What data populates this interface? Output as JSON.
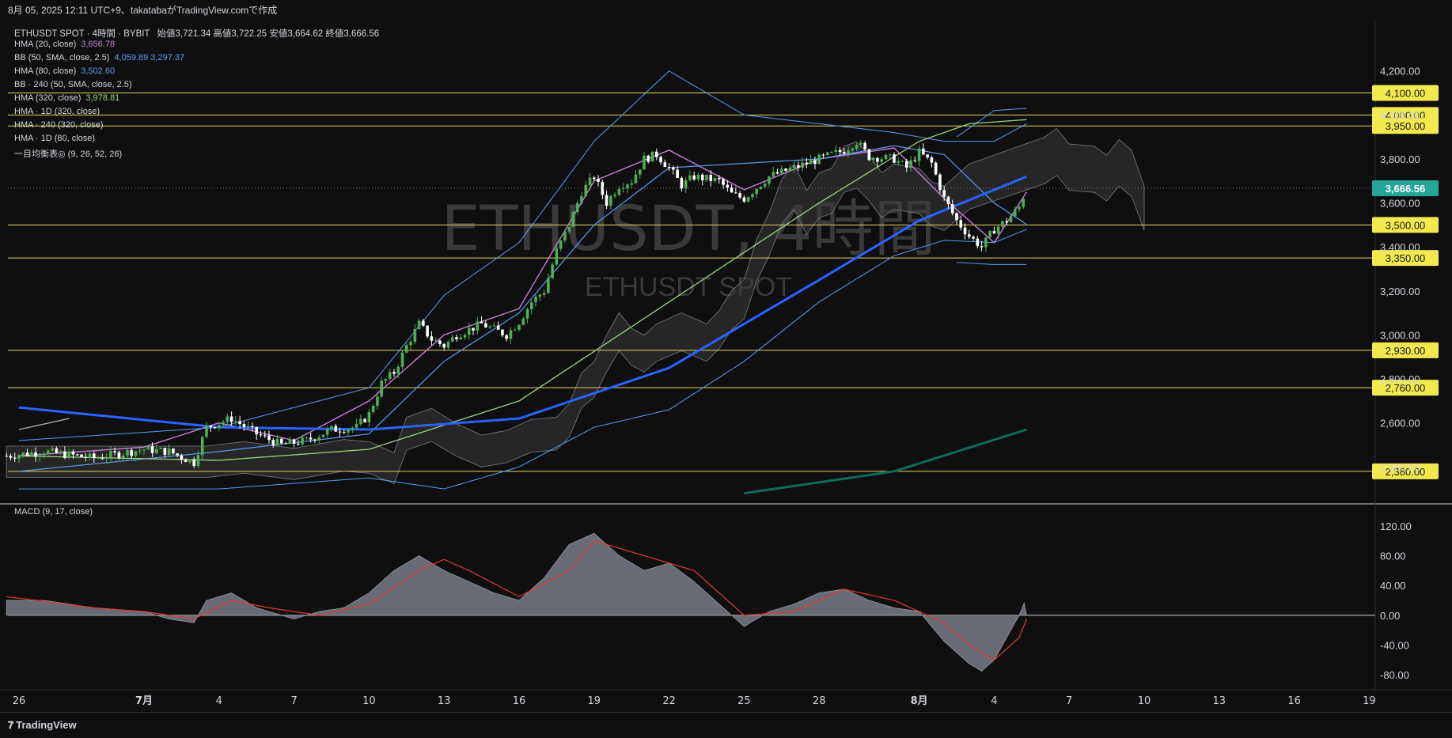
{
  "header": {
    "text": "8月 05, 2025 12:11 UTC+9、takatabaがTradingView.comで作成"
  },
  "legend": {
    "symbol": "ETHUSDT SPOT · 4時間 · BYBIT",
    "ohlc": "始値3,721.34 高値3,722.25 安値3,664.62 終値3,666.56",
    "items": [
      {
        "label": "HMA (20, close)",
        "values": "3,656.78",
        "color": "#c77dd8"
      },
      {
        "label": "BB (50, SMA, close, 2.5)",
        "values": "4,059.89 3,297.37",
        "color": "#5b9cf6"
      },
      {
        "label": "HMA (80, close)",
        "values": "3,502.60",
        "color": "#5b9cf6"
      },
      {
        "label": "BB · 240 (50, SMA, close, 2.5)",
        "values": "",
        "color": "#d1d4dc"
      },
      {
        "label": "HMA (320, close)",
        "values": "3,978.81",
        "color": "#9ad47f"
      },
      {
        "label": "HMA · 1D (320, close)",
        "values": "",
        "color": "#d1d4dc"
      },
      {
        "label": "HMA · 240 (320, close)",
        "values": "",
        "color": "#d1d4dc"
      },
      {
        "label": "HMA · 1D (80, close)",
        "values": "",
        "color": "#d1d4dc"
      },
      {
        "label": "一目均衡表◎ (9, 26, 52, 26)",
        "values": "",
        "color": "#d1d4dc"
      }
    ],
    "macd_label": "MACD (9, 17, close)"
  },
  "watermark": {
    "line1": "ETHUSDT, 4時間",
    "line2": "ETHUSDT SPOT"
  },
  "footer": {
    "logo": "TradingView"
  },
  "colors": {
    "background": "#0f0f0f",
    "up": "#4caf50",
    "down": "#ffffff",
    "level": "#e8d65c",
    "price_badge": "#26a69a",
    "hma20": "#c77dd8",
    "bb": "#5b9cf6",
    "hma80": "#5b9cf6",
    "hma240": "#2962ff",
    "hma320": "#9ad47f",
    "hma1d": "#0f6b5c",
    "macd_fill": "#787b86",
    "signal": "#e53935"
  },
  "chart_data": [
    {
      "type": "candlestick",
      "title": "ETHUSDT SPOT · 4時間 · BYBIT",
      "ylim": [
        2250,
        4350
      ],
      "y_ticks": [
        "2,400.00",
        "2,600.00",
        "2,800.00",
        "3,000.00",
        "3,200.00",
        "3,400.00",
        "3,600.00",
        "3,800.00",
        "4,000.00",
        "4,200.00"
      ],
      "x_ticks": [
        {
          "label": "26",
          "day": -5
        },
        {
          "label": "7月",
          "day": 0
        },
        {
          "label": "4",
          "day": 3
        },
        {
          "label": "7",
          "day": 6
        },
        {
          "label": "10",
          "day": 9
        },
        {
          "label": "13",
          "day": 12
        },
        {
          "label": "16",
          "day": 15
        },
        {
          "label": "19",
          "day": 18
        },
        {
          "label": "22",
          "day": 21
        },
        {
          "label": "25",
          "day": 24
        },
        {
          "label": "28",
          "day": 27
        },
        {
          "label": "8月",
          "day": 31
        },
        {
          "label": "4",
          "day": 34
        },
        {
          "label": "7",
          "day": 37
        },
        {
          "label": "10",
          "day": 40
        },
        {
          "label": "13",
          "day": 43
        },
        {
          "label": "16",
          "day": 46
        },
        {
          "label": "19",
          "day": 49
        }
      ],
      "horizontal_levels": [
        {
          "value": 4100,
          "label": "4,100.00"
        },
        {
          "value": 4000,
          "label": "4,000.00"
        },
        {
          "value": 3950,
          "label": "3,950.00"
        },
        {
          "value": 3500,
          "label": "3,500.00"
        },
        {
          "value": 3350,
          "label": "3,350.00"
        },
        {
          "value": 2930,
          "label": "2,930.00"
        },
        {
          "value": 2760,
          "label": "2,760.00"
        },
        {
          "value": 2380,
          "label": "2,380.00"
        }
      ],
      "last_price": {
        "value": 3666.56,
        "label": "3,666.56"
      },
      "anchors_day_close": [
        [
          -5.5,
          2450
        ],
        [
          -4,
          2470
        ],
        [
          -2,
          2440
        ],
        [
          0,
          2480
        ],
        [
          1,
          2470
        ],
        [
          2,
          2420
        ],
        [
          2.5,
          2580
        ],
        [
          3.5,
          2620
        ],
        [
          4.5,
          2550
        ],
        [
          5.5,
          2500
        ],
        [
          6.5,
          2520
        ],
        [
          7.5,
          2570
        ],
        [
          8.5,
          2580
        ],
        [
          9,
          2640
        ],
        [
          9.5,
          2780
        ],
        [
          10,
          2830
        ],
        [
          10.5,
          2950
        ],
        [
          11,
          3050
        ],
        [
          11.5,
          2980
        ],
        [
          12,
          2950
        ],
        [
          12.5,
          3000
        ],
        [
          13.5,
          3050
        ],
        [
          14.5,
          3000
        ],
        [
          15,
          3060
        ],
        [
          15.5,
          3150
        ],
        [
          16,
          3200
        ],
        [
          16.5,
          3380
        ],
        [
          17,
          3500
        ],
        [
          17.5,
          3650
        ],
        [
          18,
          3720
        ],
        [
          18.5,
          3600
        ],
        [
          19,
          3680
        ],
        [
          19.5,
          3700
        ],
        [
          20,
          3800
        ],
        [
          20.5,
          3820
        ],
        [
          21,
          3760
        ],
        [
          21.5,
          3680
        ],
        [
          22,
          3720
        ],
        [
          23,
          3700
        ],
        [
          23.5,
          3640
        ],
        [
          24,
          3620
        ],
        [
          25,
          3720
        ],
        [
          26,
          3760
        ],
        [
          27,
          3800
        ],
        [
          28,
          3840
        ],
        [
          28.5,
          3880
        ],
        [
          29,
          3810
        ],
        [
          30,
          3800
        ],
        [
          30.5,
          3760
        ],
        [
          31,
          3830
        ],
        [
          31.5,
          3780
        ],
        [
          32,
          3620
        ],
        [
          32.5,
          3520
        ],
        [
          33,
          3450
        ],
        [
          33.5,
          3400
        ],
        [
          34,
          3480
        ],
        [
          34.5,
          3520
        ],
        [
          35,
          3580
        ],
        [
          35.3,
          3670
        ]
      ],
      "series": [
        {
          "name": "HMA (20, close)",
          "values_at": [
            [
              -5,
              2450
            ],
            [
              0,
              2490
            ],
            [
              3,
              2600
            ],
            [
              6,
              2520
            ],
            [
              9,
              2700
            ],
            [
              12,
              3000
            ],
            [
              15,
              3120
            ],
            [
              18,
              3700
            ],
            [
              21,
              3840
            ],
            [
              24,
              3660
            ],
            [
              27,
              3800
            ],
            [
              30,
              3850
            ],
            [
              32,
              3620
            ],
            [
              34,
              3420
            ],
            [
              35.3,
              3650
            ]
          ]
        },
        {
          "name": "BB (50, SMA, close, 2.5)",
          "upper": [
            [
              -5,
              2520
            ],
            [
              3,
              2580
            ],
            [
              9,
              2760
            ],
            [
              12,
              3180
            ],
            [
              15,
              3420
            ],
            [
              18,
              3880
            ],
            [
              21,
              4200
            ],
            [
              24,
              4000
            ],
            [
              27,
              3960
            ],
            [
              30,
              3920
            ],
            [
              32,
              3880
            ],
            [
              34,
              3880
            ],
            [
              35.3,
              3960
            ]
          ],
          "lower": [
            [
              -5,
              2300
            ],
            [
              3,
              2300
            ],
            [
              9,
              2350
            ],
            [
              12,
              2300
            ],
            [
              15,
              2400
            ],
            [
              18,
              2580
            ],
            [
              21,
              2660
            ],
            [
              24,
              2880
            ],
            [
              27,
              3150
            ],
            [
              30,
              3360
            ],
            [
              32,
              3430
            ],
            [
              34,
              3420
            ],
            [
              35.3,
              3480
            ]
          ]
        },
        {
          "name": "HMA (80, close)",
          "values_at": [
            [
              -5,
              2380
            ],
            [
              3,
              2470
            ],
            [
              9,
              2550
            ],
            [
              12,
              2880
            ],
            [
              15,
              3100
            ],
            [
              18,
              3500
            ],
            [
              21,
              3760
            ],
            [
              24,
              3780
            ],
            [
              27,
              3800
            ],
            [
              30,
              3860
            ],
            [
              32,
              3820
            ],
            [
              34,
              3600
            ],
            [
              35.3,
              3502.6
            ]
          ]
        },
        {
          "name": "BB · 240 (50, SMA, close, 2.5)",
          "upper": [
            [
              32.5,
              3900
            ],
            [
              34,
              4020
            ],
            [
              35.3,
              4030
            ]
          ],
          "lower": [
            [
              32.5,
              3330
            ],
            [
              34,
              3320
            ],
            [
              35.3,
              3320
            ]
          ]
        },
        {
          "name": "HMA (320, close)",
          "values_at": [
            [
              -5,
              2450
            ],
            [
              3,
              2430
            ],
            [
              9,
              2480
            ],
            [
              15,
              2700
            ],
            [
              21,
              3150
            ],
            [
              27,
              3600
            ],
            [
              31,
              3880
            ],
            [
              33,
              3960
            ],
            [
              35.3,
              3978.81
            ]
          ]
        },
        {
          "name": "HMA · 240 (320, close)",
          "values_at": [
            [
              -5,
              2670
            ],
            [
              3,
              2580
            ],
            [
              9,
              2570
            ],
            [
              15,
              2620
            ],
            [
              21,
              2850
            ],
            [
              27,
              3250
            ],
            [
              31,
              3520
            ],
            [
              35.3,
              3720
            ]
          ]
        },
        {
          "name": "HMA · 1D (320, close)",
          "values_at": [
            [
              -5,
              2570
            ],
            [
              -3,
              2620
            ]
          ]
        },
        {
          "name": "HMA · 1D (80, close)",
          "values_at": [
            [
              24,
              2280
            ],
            [
              30,
              2380
            ],
            [
              35.3,
              2570
            ]
          ]
        }
      ]
    },
    {
      "type": "area",
      "title": "MACD (9, 17, close)",
      "ylim": [
        -100,
        140
      ],
      "y_ticks": [
        "-80.00",
        "-40.00",
        "0.00",
        "40.00",
        "80.00",
        "120.00"
      ],
      "macd": [
        [
          -5.5,
          20
        ],
        [
          -4,
          20
        ],
        [
          -2,
          10
        ],
        [
          0,
          5
        ],
        [
          1,
          -5
        ],
        [
          2,
          -10
        ],
        [
          2.5,
          20
        ],
        [
          3.5,
          30
        ],
        [
          4.5,
          10
        ],
        [
          6,
          -5
        ],
        [
          7,
          5
        ],
        [
          8,
          10
        ],
        [
          9,
          30
        ],
        [
          10,
          60
        ],
        [
          11,
          80
        ],
        [
          12,
          60
        ],
        [
          13,
          45
        ],
        [
          14,
          30
        ],
        [
          15,
          20
        ],
        [
          16,
          50
        ],
        [
          17,
          95
        ],
        [
          18,
          110
        ],
        [
          19,
          80
        ],
        [
          20,
          60
        ],
        [
          21,
          70
        ],
        [
          22,
          45
        ],
        [
          23,
          15
        ],
        [
          24,
          -15
        ],
        [
          25,
          5
        ],
        [
          26,
          15
        ],
        [
          27,
          30
        ],
        [
          28,
          35
        ],
        [
          29,
          20
        ],
        [
          30,
          10
        ],
        [
          31,
          5
        ],
        [
          32,
          -35
        ],
        [
          33,
          -65
        ],
        [
          33.5,
          -75
        ],
        [
          34,
          -60
        ],
        [
          35,
          0
        ],
        [
          35.3,
          25
        ]
      ],
      "signal": [
        [
          -5.5,
          25
        ],
        [
          -2,
          10
        ],
        [
          0,
          5
        ],
        [
          2,
          -5
        ],
        [
          3.5,
          20
        ],
        [
          5,
          10
        ],
        [
          7,
          0
        ],
        [
          9,
          15
        ],
        [
          11,
          60
        ],
        [
          12,
          75
        ],
        [
          13,
          60
        ],
        [
          15,
          25
        ],
        [
          17,
          60
        ],
        [
          18,
          100
        ],
        [
          19,
          90
        ],
        [
          21,
          70
        ],
        [
          22,
          60
        ],
        [
          24,
          0
        ],
        [
          26,
          5
        ],
        [
          28,
          35
        ],
        [
          30,
          20
        ],
        [
          31,
          5
        ],
        [
          32,
          -10
        ],
        [
          33,
          -40
        ],
        [
          34,
          -60
        ],
        [
          35,
          -30
        ],
        [
          35.3,
          -5
        ]
      ]
    }
  ]
}
